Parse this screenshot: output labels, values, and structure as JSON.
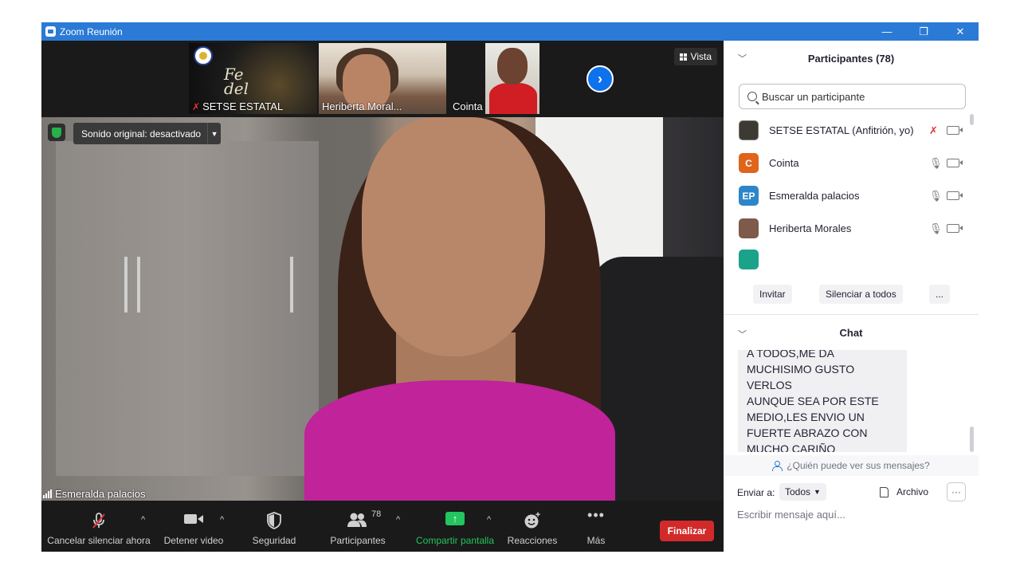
{
  "window": {
    "title": "Zoom Reunión",
    "minimize": "—",
    "maximize": "❐",
    "close": "✕"
  },
  "thumbnails": [
    {
      "name": "SETSE ESTATAL",
      "muted": true,
      "script_text": "Fe\ndel"
    },
    {
      "name": "Heriberta Moral..."
    },
    {
      "name": "Cointa"
    }
  ],
  "thumb_next": "›",
  "view_button": "Vista",
  "main_video": {
    "audio_setting": "Sonido original: desactivado",
    "speaker": "Esmeralda palacios"
  },
  "toolbar": {
    "unmute": "Cancelar silenciar ahora",
    "stop_video": "Detener video",
    "security": "Seguridad",
    "participants": "Participantes",
    "participants_count": "78",
    "share": "Compartir pantalla",
    "reactions": "Reacciones",
    "more": "Más",
    "end": "Finalizar"
  },
  "participants_panel": {
    "title": "Participantes (78)",
    "search_placeholder": "Buscar un participante",
    "list": [
      {
        "name": "SETSE ESTATAL (Anfitrión, yo)",
        "avatar": "",
        "avatar_color": "#3c3a32",
        "muted": true
      },
      {
        "name": "Cointa",
        "avatar": "C",
        "avatar_color": "#e0641a",
        "muted": false
      },
      {
        "name": "Esmeralda palacios",
        "avatar": "EP",
        "avatar_color": "#2e86c9",
        "muted": false
      },
      {
        "name": "Heriberta Morales",
        "avatar": "",
        "avatar_color": "#7d5a4a",
        "muted": false
      }
    ],
    "invite": "Invitar",
    "mute_all": "Silenciar a todos",
    "more": "..."
  },
  "chat": {
    "title": "Chat",
    "message": "A TODOS,ME DA\nMUCHISIMO GUSTO VERLOS\nAUNQUE SEA POR ESTE\nMEDIO,LES ENVIO UN\nFUERTE ABRAZO CON\nMUCHO CARIÑO",
    "who_can_see": "¿Quién puede ver sus mensajes?",
    "send_to_label": "Enviar a:",
    "send_to_value": "Todos",
    "file": "Archivo",
    "more": "···",
    "input_placeholder": "Escribir mensaje aquí..."
  },
  "colors": {
    "accent": "#2b7ad6",
    "end_button": "#d22a2a",
    "share_green": "#22c55e",
    "muted_red": "#e8333c"
  }
}
